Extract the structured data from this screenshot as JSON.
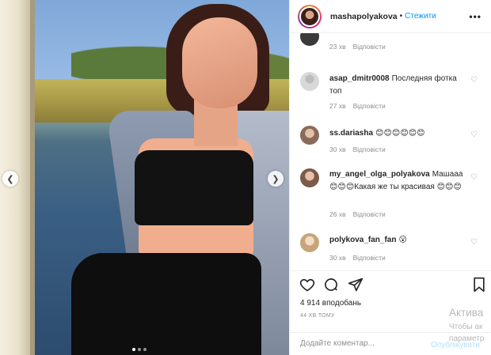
{
  "post": {
    "username": "mashapolyakova",
    "separator": "•",
    "follow_label": "Стежити",
    "more_icon": "more-horizontal-icon",
    "carousel": {
      "current": 1,
      "total": 3
    }
  },
  "comments": [
    {
      "username": "",
      "text": "",
      "time": "23 хв",
      "reply": "Відповісти",
      "avatar_color": "#3a3a3a"
    },
    {
      "username": "asap_dmitr0008",
      "text": "Последняя фотка топ",
      "time": "27 хв",
      "reply": "Відповісти",
      "avatar_color": "#d8d8d8"
    },
    {
      "username": "ss.dariasha",
      "text": "😊😊😊😊😊😊",
      "time": "30 хв",
      "reply": "Відповісти",
      "avatar_color": "#c9a890"
    },
    {
      "username": "my_angel_olga_polyakova",
      "text": "Машааа😊😊😊Какая же ты красивая 😊😊😊",
      "time": "26 хв",
      "reply": "Відповісти",
      "avatar_color": "#b58a77"
    },
    {
      "username": "polykova_fan_fan",
      "text": "😮",
      "time": "30 хв",
      "reply": "Відповісти",
      "avatar_color": "#e8d8c0"
    }
  ],
  "actions": {
    "like_icon": "heart-icon",
    "comment_icon": "comment-icon",
    "share_icon": "send-icon",
    "save_icon": "bookmark-icon"
  },
  "likes_text": "4 914 вподобань",
  "post_time": "44 ХВ ТОМУ",
  "add_comment": {
    "placeholder": "Додайте коментар...",
    "publish_label": "Опублікувати"
  },
  "watermark": {
    "line1": "Актива",
    "line2": "Чтобы ак",
    "line3": "параметр"
  }
}
